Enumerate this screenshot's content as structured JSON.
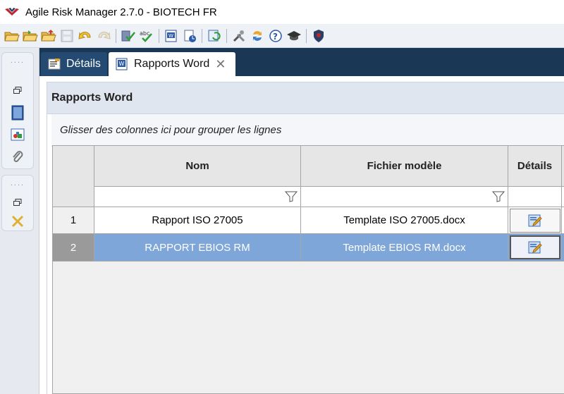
{
  "window": {
    "title": "Agile Risk Manager 2.7.0 - BIOTECH FR"
  },
  "toolbar": {
    "icons": [
      "open-folder-icon",
      "open-folder-arrow-icon",
      "folder-up-icon",
      "save-icon",
      "undo-icon",
      "redo-icon",
      "validate-icon",
      "spellcheck-icon",
      "report-word-icon",
      "report-generate-icon",
      "refresh-icon",
      "tools-icon",
      "sync-icon",
      "help-icon",
      "graduation-cap-icon",
      "shield-icon"
    ]
  },
  "tabs": [
    {
      "label": "Détails",
      "icon": "details-icon",
      "active": false
    },
    {
      "label": "Rapports Word",
      "icon": "word-icon",
      "active": true,
      "close": "✕"
    }
  ],
  "panel": {
    "title": "Rapports Word",
    "group_hint": "Glisser des colonnes ici pour grouper les lignes"
  },
  "grid": {
    "columns": [
      "Nom",
      "Fichier modèle",
      "Détails"
    ],
    "rows": [
      {
        "num": "1",
        "nom": "Rapport ISO 27005",
        "fichier": "Template ISO 27005.docx",
        "selected": false
      },
      {
        "num": "2",
        "nom": "RAPPORT EBIOS RM",
        "fichier": "Template EBIOS RM.docx",
        "selected": true
      }
    ]
  },
  "colors": {
    "selection": "#7ea6d8",
    "tabstrip": "#1b3756",
    "brand_red": "#c0262d"
  }
}
